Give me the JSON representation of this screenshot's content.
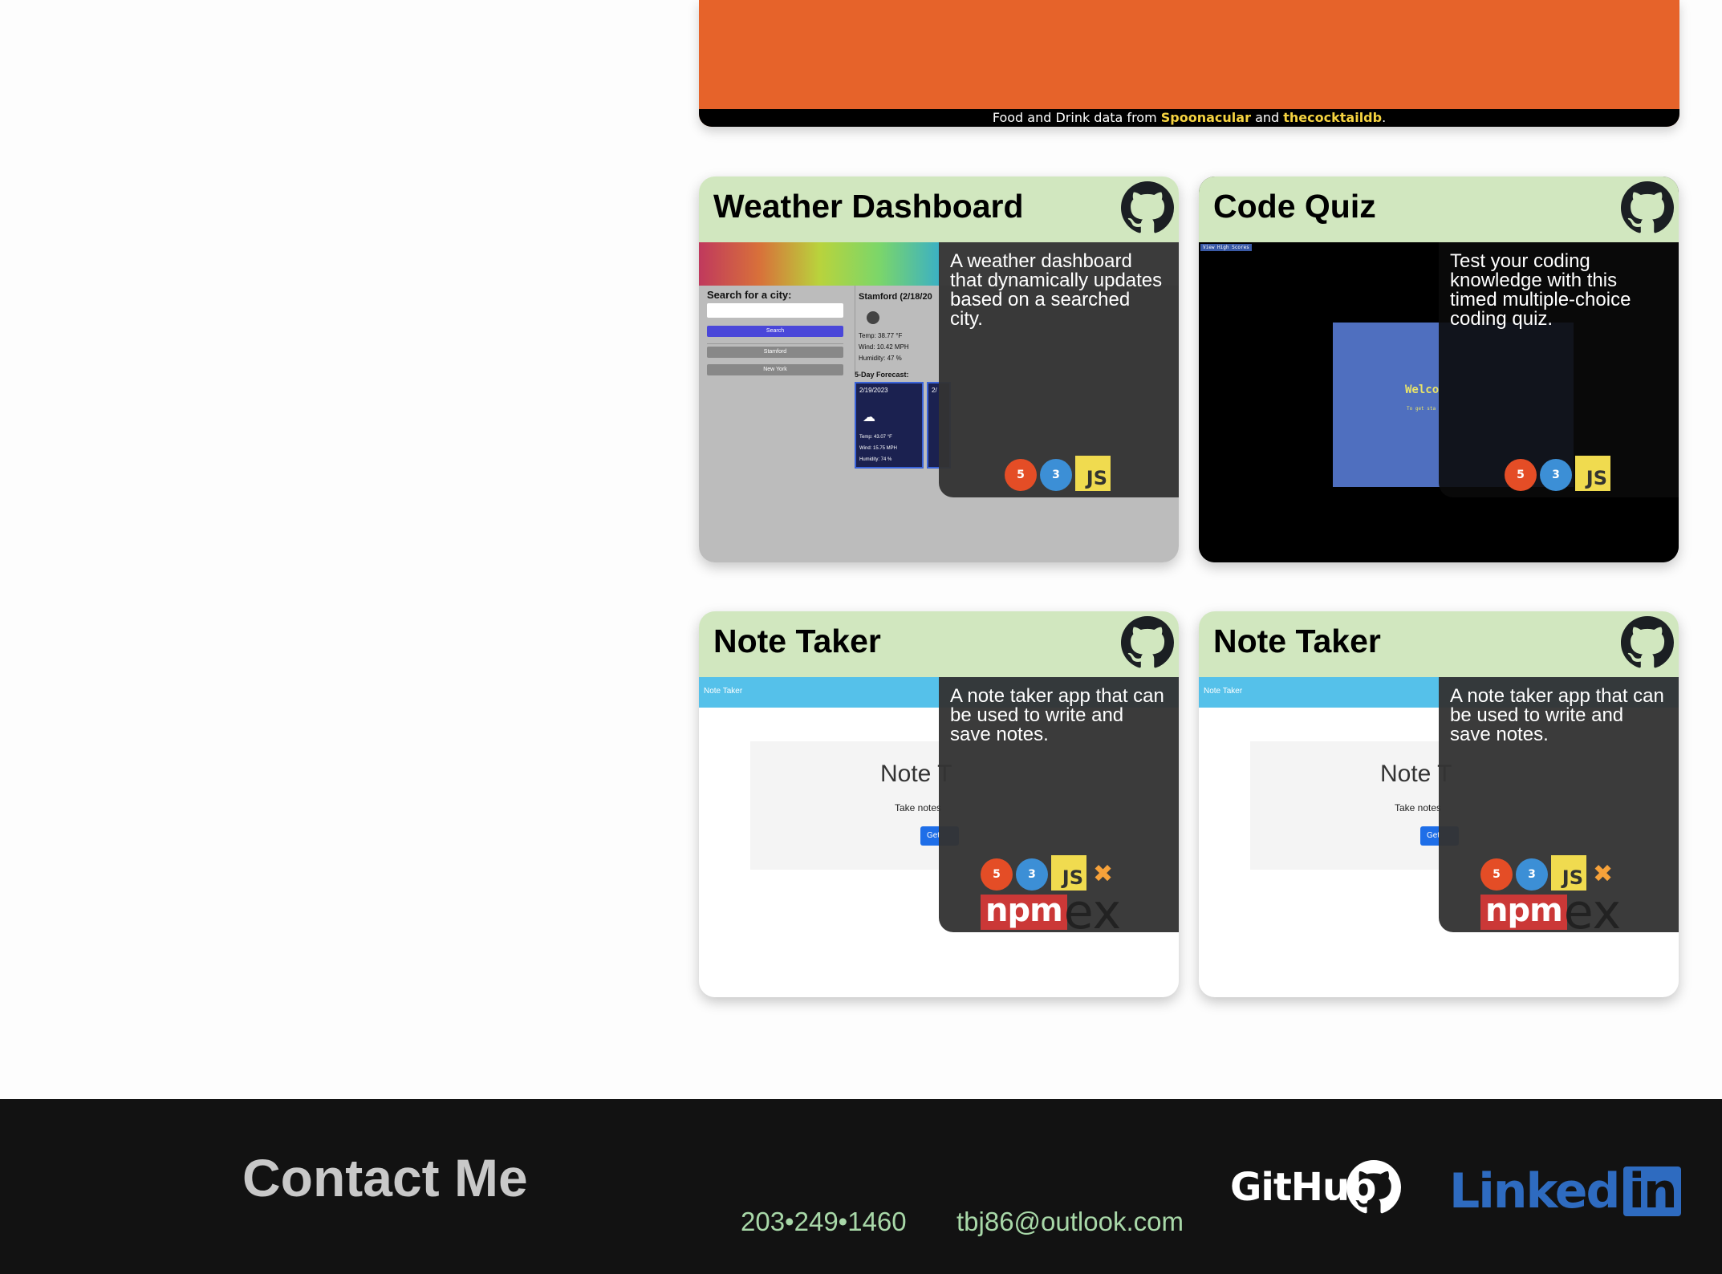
{
  "top_card": {
    "credit_prefix": "Food and Drink data from",
    "credit_link1": "Spoonacular",
    "credit_mid": "and",
    "credit_link2": "thecocktaildb",
    "credit_suffix": "."
  },
  "cards": [
    {
      "title": "Weather Dashboard",
      "description": "A weather dashboard that dynamically updates based on a searched city.",
      "preview": {
        "search_label": "Search for a city:",
        "search_button": "Search",
        "history": [
          "Stamford",
          "New York"
        ],
        "city_heading": "Stamford  (2/18/20",
        "temp": "Temp: 38.77 °F",
        "wind": "Wind: 10.42 MPH",
        "humidity": "Humidity: 47 %",
        "forecast_label": "5-Day Forecast:",
        "forecast_date": "2/19/2023",
        "forecast_date2": "2/",
        "f_temp": "Temp: 43.07 °F",
        "f_wind": "Wind: 15.75 MPH",
        "f_humidity": "Humidity: 74 %"
      },
      "tech": [
        "html5-icon",
        "css3-icon",
        "javascript-icon"
      ]
    },
    {
      "title": "Code Quiz",
      "description": "Test your coding knowledge with this timed multiple-choice coding quiz.",
      "preview": {
        "high_scores": "View High Scores",
        "welcome": "Welco",
        "sub": "To get sta"
      },
      "tech": [
        "html5-icon",
        "css3-icon",
        "javascript-icon"
      ]
    },
    {
      "title": "Note Taker",
      "description": "A note taker app that can be used to write and save notes.",
      "preview": {
        "nav": "Note Taker",
        "heading": "Note T",
        "sub": "Take notes",
        "button": "Get"
      },
      "tech": [
        "html5-icon",
        "css3-icon",
        "javascript-icon",
        "express-icon",
        "npm-icon"
      ]
    },
    {
      "title": "Note Taker",
      "description": "A note taker app that can be used to write and save notes.",
      "preview": {
        "nav": "Note Taker",
        "heading": "Note T",
        "sub": "Take notes",
        "button": "Get"
      },
      "tech": [
        "html5-icon",
        "css3-icon",
        "javascript-icon",
        "express-icon",
        "npm-icon"
      ]
    }
  ],
  "tech_labels": {
    "js": "JS",
    "npm": "npm",
    "ex": "ex"
  },
  "footer": {
    "title": "Contact Me",
    "phone": "203•249•1460",
    "email": "tbj86@outlook.com",
    "github": "GitHub",
    "linkedin_a": "Linked",
    "linkedin_b": "in"
  },
  "colors": {
    "accent_orange": "#e6632a",
    "card_header": "#d1e7bf",
    "footer_bg": "#121212",
    "contact_link": "#a8d8a8",
    "linkedin_blue": "#2e6bc0"
  }
}
